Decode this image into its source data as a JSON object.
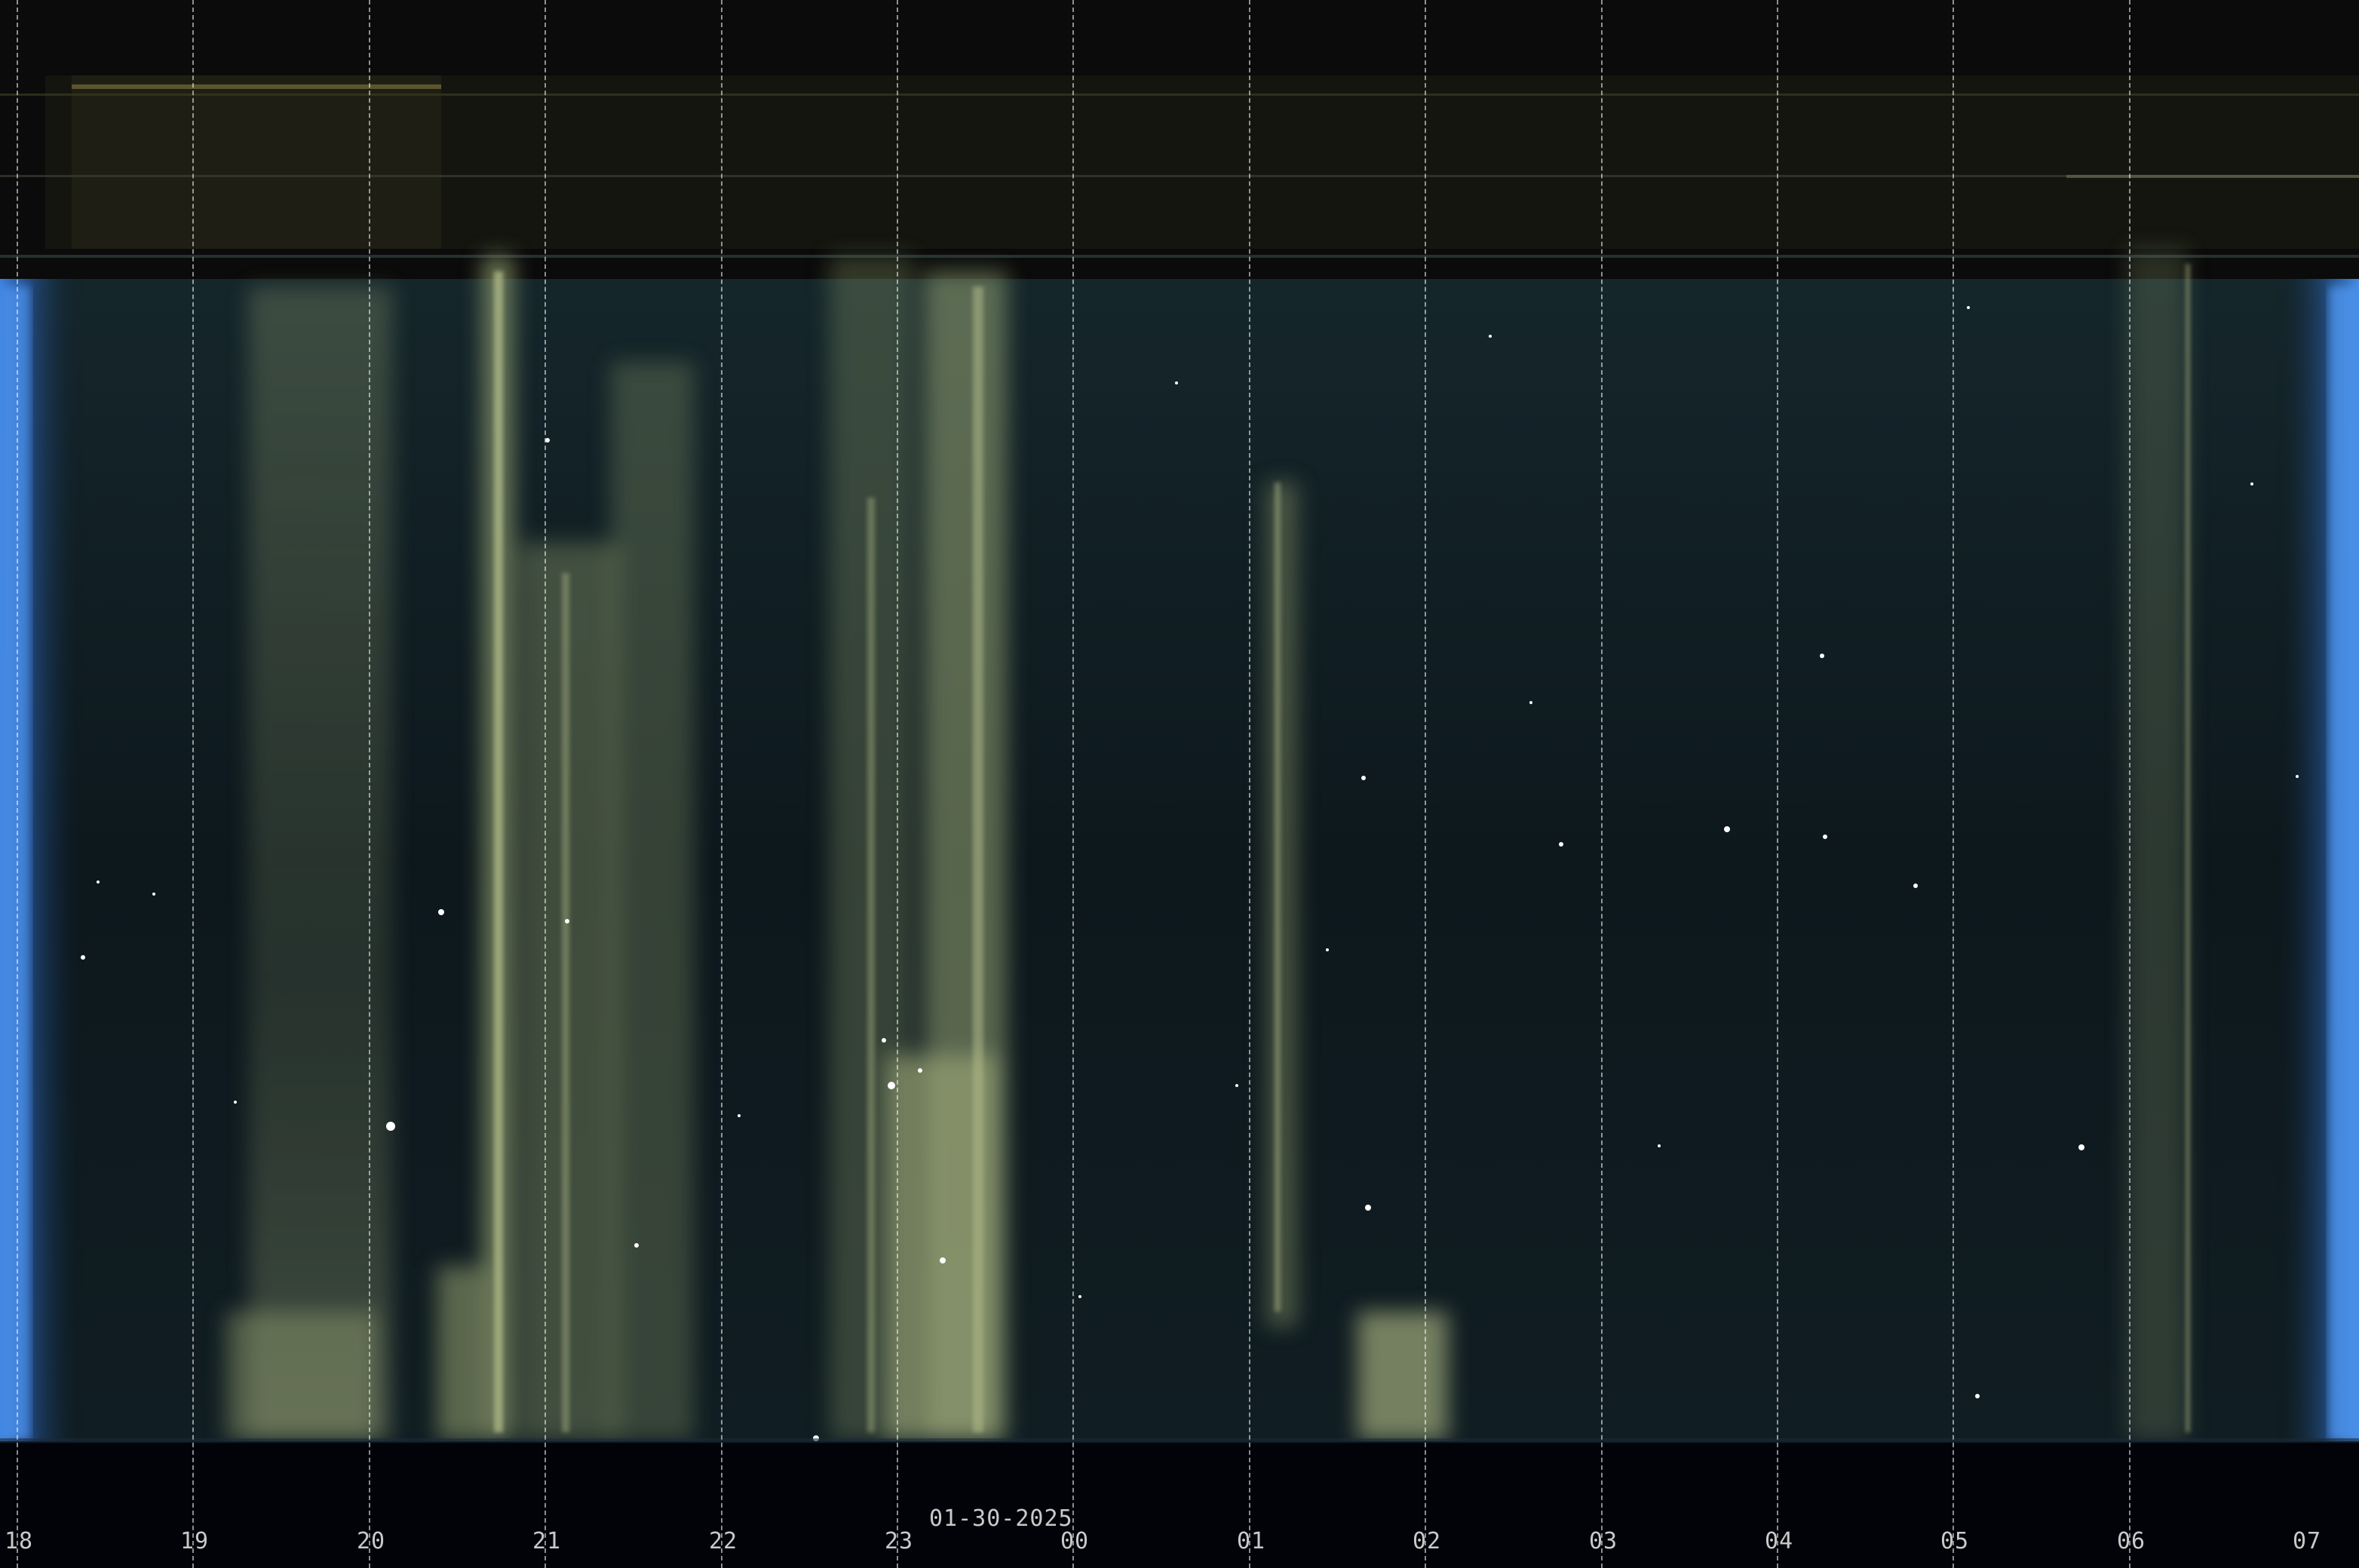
{
  "keogram": {
    "date": "01-30-2025",
    "hour_labels": [
      "18",
      "19",
      "20",
      "21",
      "22",
      "23",
      "00",
      "01",
      "02",
      "03",
      "04",
      "05",
      "06",
      "07"
    ],
    "colors": {
      "sky": "#0f1c22",
      "aurora": "#8d9a6b",
      "twilight_edge": "#3f86e8",
      "top_band": "#151610",
      "bottom_band": "#020309",
      "label": "#c9c9c9",
      "grid": "#ffffff"
    }
  }
}
